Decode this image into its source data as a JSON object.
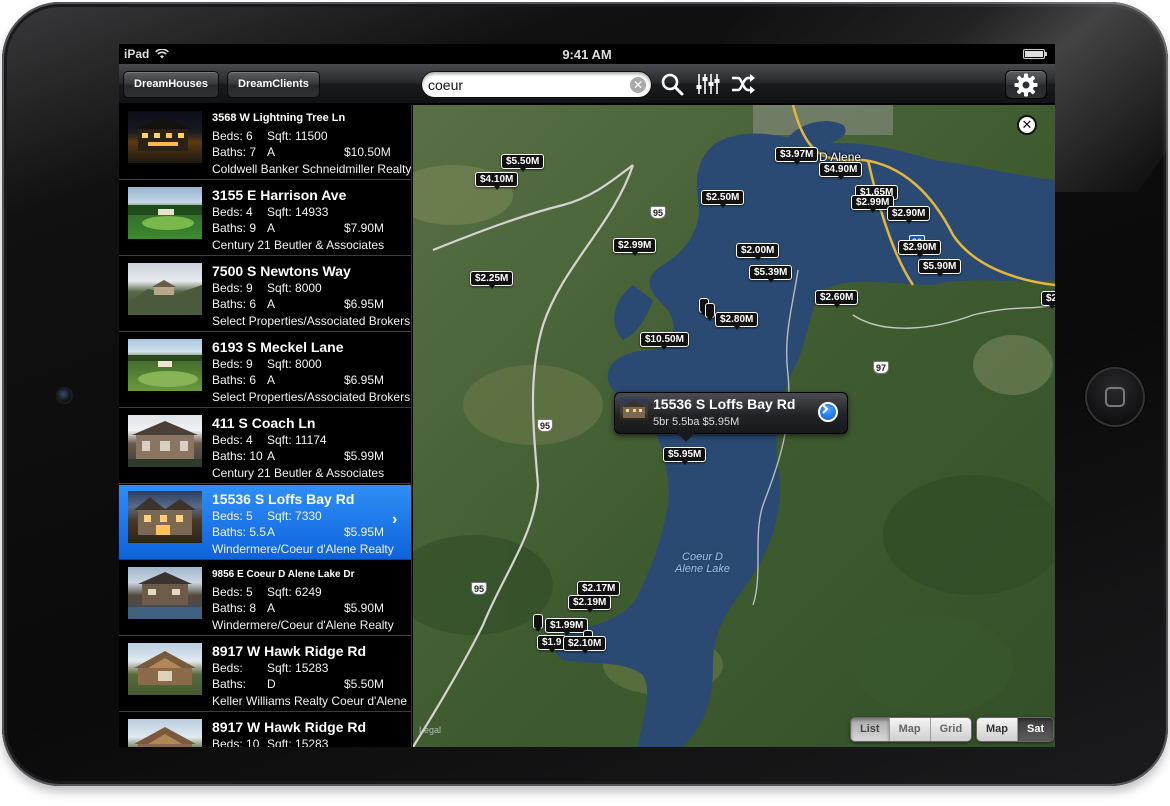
{
  "statusbar": {
    "device": "iPad",
    "time": "9:41 AM"
  },
  "toolbar": {
    "btn1": "DreamHouses",
    "btn2": "DreamClients",
    "search_value": "coeur",
    "search_clear": "✕"
  },
  "listings": [
    {
      "address": "3568 W Lightning Tree Ln",
      "beds": "Beds: 6",
      "sqft": "Sqft: 11500",
      "baths": "Baths: 7",
      "status": "A",
      "price": "$10.50M",
      "broker": "Coldwell Banker Schneidmiller Realty"
    },
    {
      "address": "3155 E Harrison Ave",
      "beds": "Beds: 4",
      "sqft": "Sqft: 14933",
      "baths": "Baths: 9",
      "status": "A",
      "price": "$7.90M",
      "broker": "Century 21 Beutler & Associates"
    },
    {
      "address": "7500 S Newtons Way",
      "beds": "Beds: 9",
      "sqft": "Sqft: 8000",
      "baths": "Baths: 6",
      "status": "A",
      "price": "$6.95M",
      "broker": "Select Properties/Associated Brokers"
    },
    {
      "address": "6193 S Meckel Lane",
      "beds": "Beds: 9",
      "sqft": "Sqft: 8000",
      "baths": "Baths: 6",
      "status": "A",
      "price": "$6.95M",
      "broker": "Select Properties/Associated Brokers"
    },
    {
      "address": "411 S Coach Ln",
      "beds": "Beds: 4",
      "sqft": "Sqft: 11174",
      "baths": "Baths: 10",
      "status": "A",
      "price": "$5.99M",
      "broker": "Century 21 Beutler & Associates"
    },
    {
      "address": "15536 S Loffs Bay Rd",
      "beds": "Beds: 5",
      "sqft": "Sqft: 7330",
      "baths": "Baths: 5.5",
      "status": "A",
      "price": "$5.95M",
      "broker": "Windermere/Coeur d'Alene Realty"
    },
    {
      "address": "9856 E Coeur D Alene Lake Dr",
      "beds": "Beds: 5",
      "sqft": "Sqft: 6249",
      "baths": "Baths: 8",
      "status": "A",
      "price": "$5.90M",
      "broker": "Windermere/Coeur d'Alene Realty"
    },
    {
      "address": "8917 W Hawk Ridge Rd",
      "beds": "Beds:",
      "sqft": "Sqft: 15283",
      "baths": "Baths:",
      "status": "D",
      "price": "$5.50M",
      "broker": "Keller Williams Realty Coeur d'Alene"
    },
    {
      "address": "8917 W Hawk Ridge Rd",
      "beds": "Beds: 10",
      "sqft": "Sqft: 15283",
      "baths": "",
      "status": "",
      "price": "",
      "broker": ""
    }
  ],
  "map": {
    "city_label": "Coeur D Alene",
    "lake_label_1": "Coeur D",
    "lake_label_2": "Alene Lake",
    "legal": "Legal",
    "close": "✕",
    "hwy_95": "95",
    "hwy_90": "90",
    "hwy_97": "97",
    "pins": [
      "$5.50M",
      "$4.10M",
      "$3.97M",
      "$4.90M",
      "$1.65M",
      "$2.99M",
      "$2.90M",
      "$2.50M",
      "$2.99M",
      "$2.90M",
      "$2.00M",
      "$5.90M",
      "$5.39M",
      "$2.25M",
      "$2.60M",
      "$2",
      "$2.80M",
      "$10.50M",
      "$5.95M",
      "$2.17M",
      "$2.19M",
      "$1.99M",
      "$1.9",
      "$2.10M"
    ],
    "callout": {
      "title": "15536 S Loffs Bay Rd",
      "subtitle": "5br 5.5ba $5.95M"
    },
    "view_mode": [
      "List",
      "Map",
      "Grid"
    ],
    "view_mode_selected": "List",
    "map_type": [
      "Map",
      "Sat"
    ],
    "map_type_selected": "Sat"
  },
  "colors": {
    "selected_row": "#0e63dd",
    "water": "#2a4a73",
    "land": "#47633a"
  }
}
